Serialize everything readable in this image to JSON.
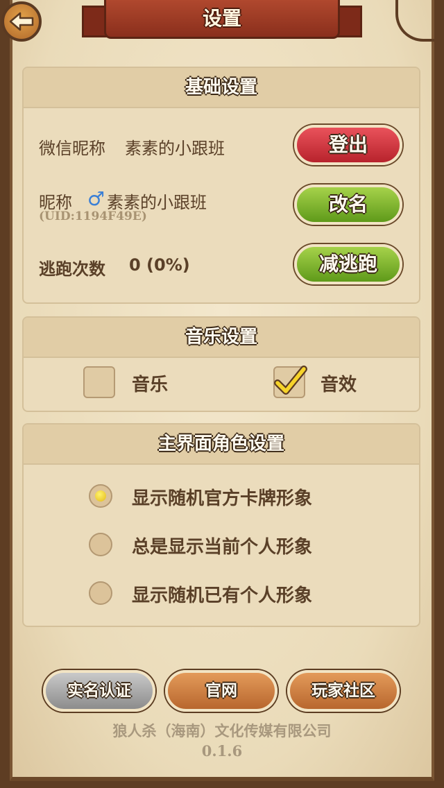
{
  "header": {
    "title": "设置",
    "back_icon": "back-arrow-icon"
  },
  "basic": {
    "title": "基础设置",
    "wechat_label": "微信昵称",
    "wechat_value": "素素的小跟班",
    "nickname_label": "昵称",
    "gender_icon": "male-icon",
    "nickname_value": "素素的小跟班",
    "uid": "(UID:1194F49E)",
    "escape_label": "逃跑次数",
    "escape_value": "0 (0%)",
    "logout_label": "登出",
    "rename_label": "改名",
    "reduce_escape_label": "减逃跑"
  },
  "music": {
    "title": "音乐设置",
    "music_label": "音乐",
    "music_checked": false,
    "sfx_label": "音效",
    "sfx_checked": true
  },
  "character": {
    "title": "主界面角色设置",
    "options": [
      {
        "label": "显示随机官方卡牌形象",
        "selected": true
      },
      {
        "label": "总是显示当前个人形象",
        "selected": false
      },
      {
        "label": "显示随机已有个人形象",
        "selected": false
      }
    ]
  },
  "buttons": {
    "realname": "实名认证",
    "website": "官网",
    "community": "玩家社区"
  },
  "footer": {
    "company": "狼人杀（海南）文化传媒有限公司",
    "version": "0.1.6"
  },
  "colors": {
    "red_button": "#d13a43",
    "green_button": "#7fb52c",
    "orange_button": "#c97a3e",
    "gray_button": "#a9a9a9",
    "banner": "#9c3b23"
  }
}
